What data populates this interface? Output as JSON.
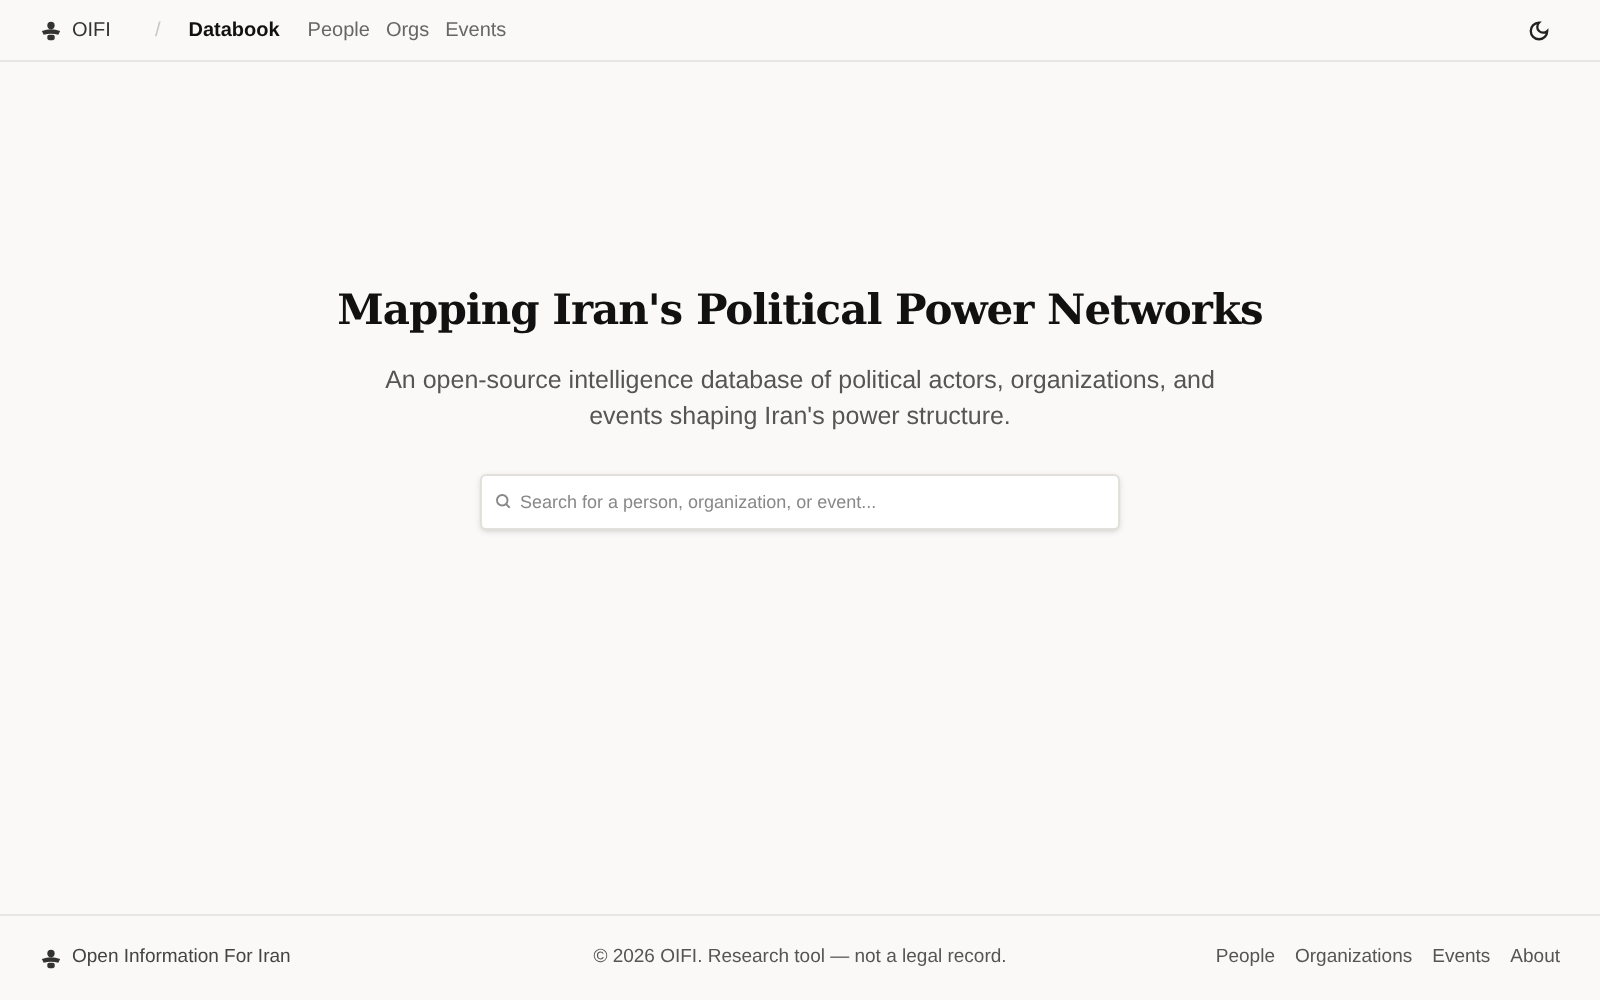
{
  "header": {
    "brand": "OIFI",
    "separator": "/",
    "nav": [
      {
        "label": "Databook",
        "selected": true
      },
      {
        "label": "People",
        "selected": false
      },
      {
        "label": "Orgs",
        "selected": false
      },
      {
        "label": "Events",
        "selected": false
      }
    ]
  },
  "hero": {
    "title": "Mapping Iran's Political Power Networks",
    "subtitle": "An open-source intelligence database of political actors, organizations, and events shaping Iran's power structure.",
    "search": {
      "placeholder": "Search for a person, organization, or event..."
    }
  },
  "footer": {
    "brand": "Open Information For Iran",
    "copyright": "© 2026 OIFI. Research tool — not a legal record.",
    "links": [
      "People",
      "Organizations",
      "Events",
      "About"
    ]
  }
}
